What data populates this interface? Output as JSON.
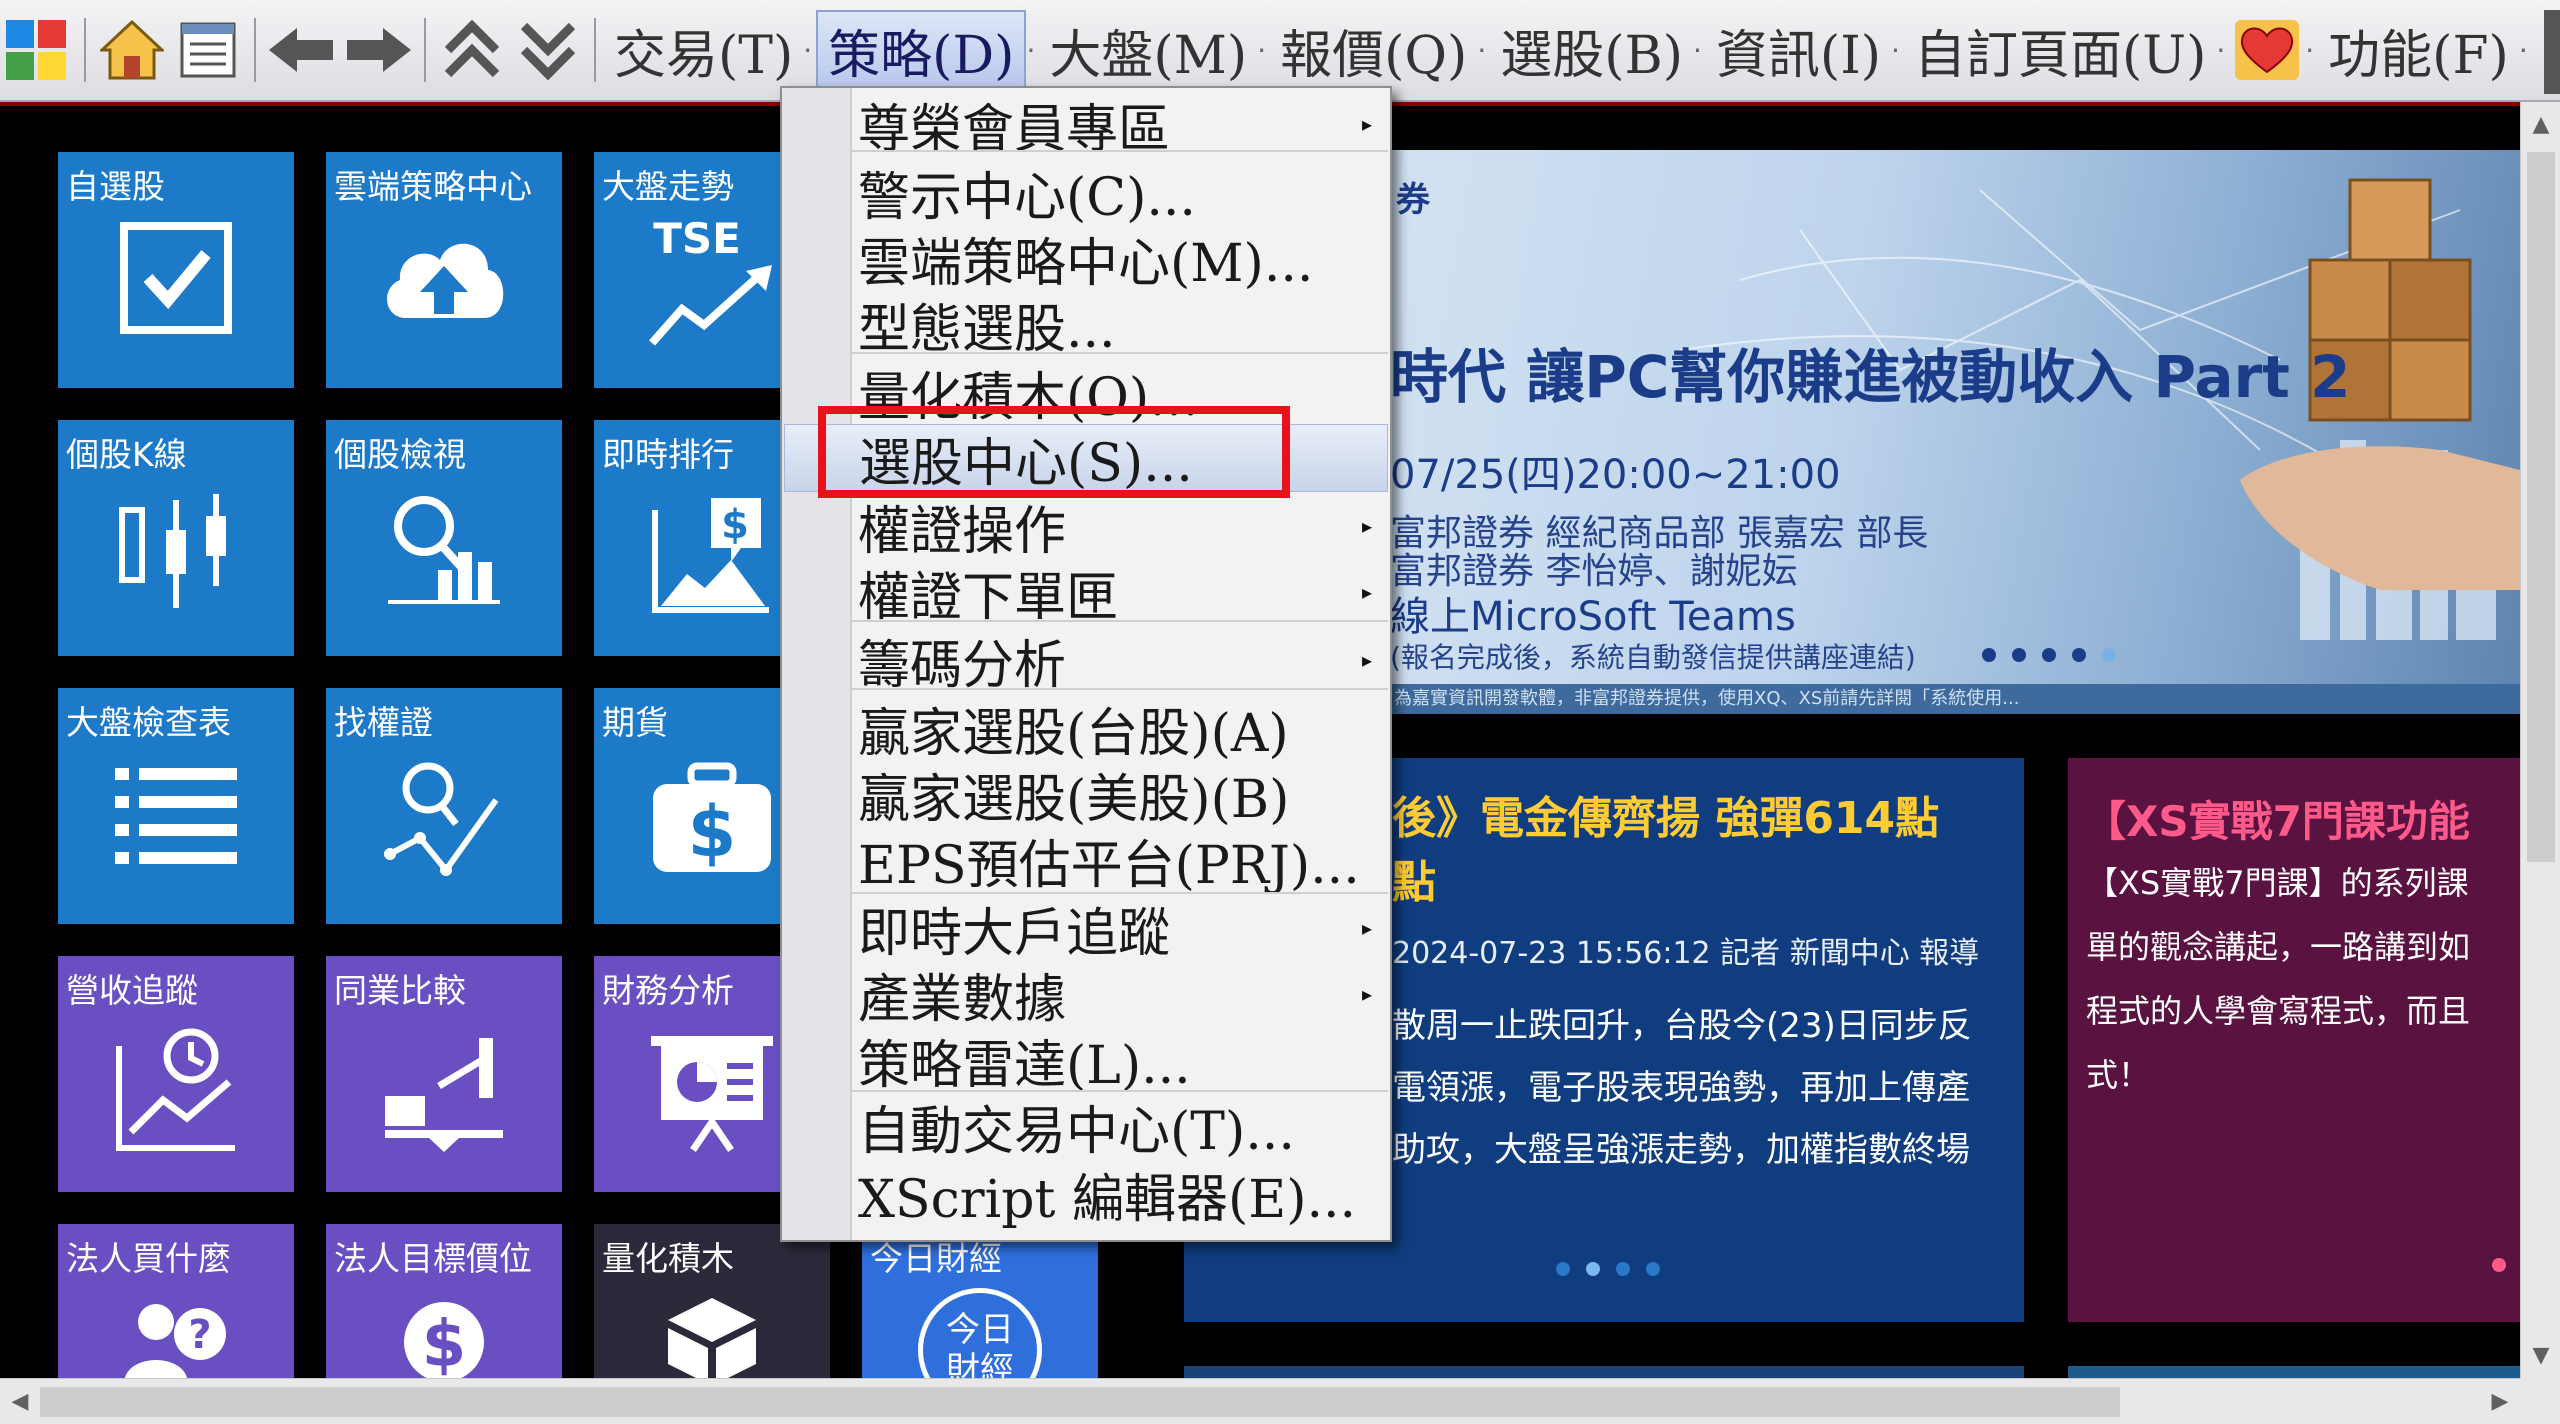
{
  "menubar": {
    "items": [
      {
        "label": "交易(T)"
      },
      {
        "label": "策略(D)"
      },
      {
        "label": "大盤(M)"
      },
      {
        "label": "報價(Q)"
      },
      {
        "label": "選股(B)"
      },
      {
        "label": "資訊(I)"
      },
      {
        "label": "自訂頁面(U)"
      },
      {
        "label": "功能(F)"
      }
    ],
    "icons": [
      "windows-grid-icon",
      "home-icon",
      "list-document-icon",
      "back-arrow-icon",
      "forward-arrow-icon",
      "double-up-icon",
      "double-down-icon",
      "heart-icon"
    ]
  },
  "tiles": [
    {
      "label": "自選股"
    },
    {
      "label": "雲端策略中心"
    },
    {
      "label": "大盤走勢",
      "icon_text": "TSE"
    },
    {
      "label": "個股K線"
    },
    {
      "label": "個股檢視"
    },
    {
      "label": "即時排行"
    },
    {
      "label": "大盤檢查表"
    },
    {
      "label": "找權證"
    },
    {
      "label": "期貨"
    },
    {
      "label": "營收追蹤"
    },
    {
      "label": "同業比較"
    },
    {
      "label": "財務分析"
    },
    {
      "label": "法人買什麼"
    },
    {
      "label": "法人目標價位"
    },
    {
      "label": "量化積木"
    },
    {
      "label": "今日財經",
      "icon_text_line1": "今日",
      "icon_text_line2": "財經"
    }
  ],
  "dropdown": {
    "items": [
      {
        "label": "尊榮會員專區",
        "submenu": true
      },
      {
        "label": "警示中心(C)..."
      },
      {
        "label": "雲端策略中心(M)..."
      },
      {
        "label": "型態選股..."
      },
      {
        "label": "量化積木(O)..."
      },
      {
        "label": "選股中心(S)...",
        "highlighted": true
      },
      {
        "label": "權證操作",
        "submenu": true
      },
      {
        "label": "權證下單匣",
        "submenu": true
      },
      {
        "label": "籌碼分析",
        "submenu": true
      },
      {
        "label": "贏家選股(台股)(A)"
      },
      {
        "label": "贏家選股(美股)(B)"
      },
      {
        "label": "EPS預估平台(PRJ)..."
      },
      {
        "label": "即時大戶追蹤",
        "submenu": true
      },
      {
        "label": "產業數據",
        "submenu": true
      },
      {
        "label": "策略雷達(L)..."
      },
      {
        "label": "自動交易中心(T)..."
      },
      {
        "label": "XScript 編輯器(E)..."
      }
    ],
    "submenu_glyph": "▸"
  },
  "banner": {
    "corner": "券",
    "title_prefix": "時代 讓",
    "title_pc": "PC",
    "title_mid": "幫你賺進被動收入 ",
    "title_part": "Part 2",
    "datetime": "07/25(四)20:00~21:00",
    "speaker1": "富邦證券 經紀商品部 張嘉宏 部長",
    "speaker2": "富邦證券 李怡婷、謝妮妘",
    "platform": "線上MicroSoft Teams",
    "note": "(報名完成後，系統自動發信提供講座連結)",
    "footer": "為嘉實資訊開發軟體，非富邦證券提供，使用XQ、XS前請先詳閱「系統使用..."
  },
  "news": {
    "headline1": "後》電金傳齊揚 強彈614點",
    "headline2": "點",
    "meta": "2024-07-23 15:56:12 記者 新聞中心 報導",
    "body": [
      "散周一止跌回升，台股今(23)日同步反",
      "電領漲，電子股表現強勢，再加上傳產",
      "助攻，大盤呈強漲走勢，加權指數終場"
    ]
  },
  "course": {
    "title": "【XS實戰7門課功能",
    "body": [
      "【XS實戰7門課】的系列課",
      "單的觀念講起，一路講到如",
      "程式的人學會寫程式，而且",
      "式！"
    ]
  },
  "colors": {
    "tile_blue": "#1d7ac8",
    "tile_purple": "#6a4fc2",
    "news_bg": "#0f3d80",
    "course_bg": "#5a1240",
    "highlight_red": "#e8121b"
  }
}
